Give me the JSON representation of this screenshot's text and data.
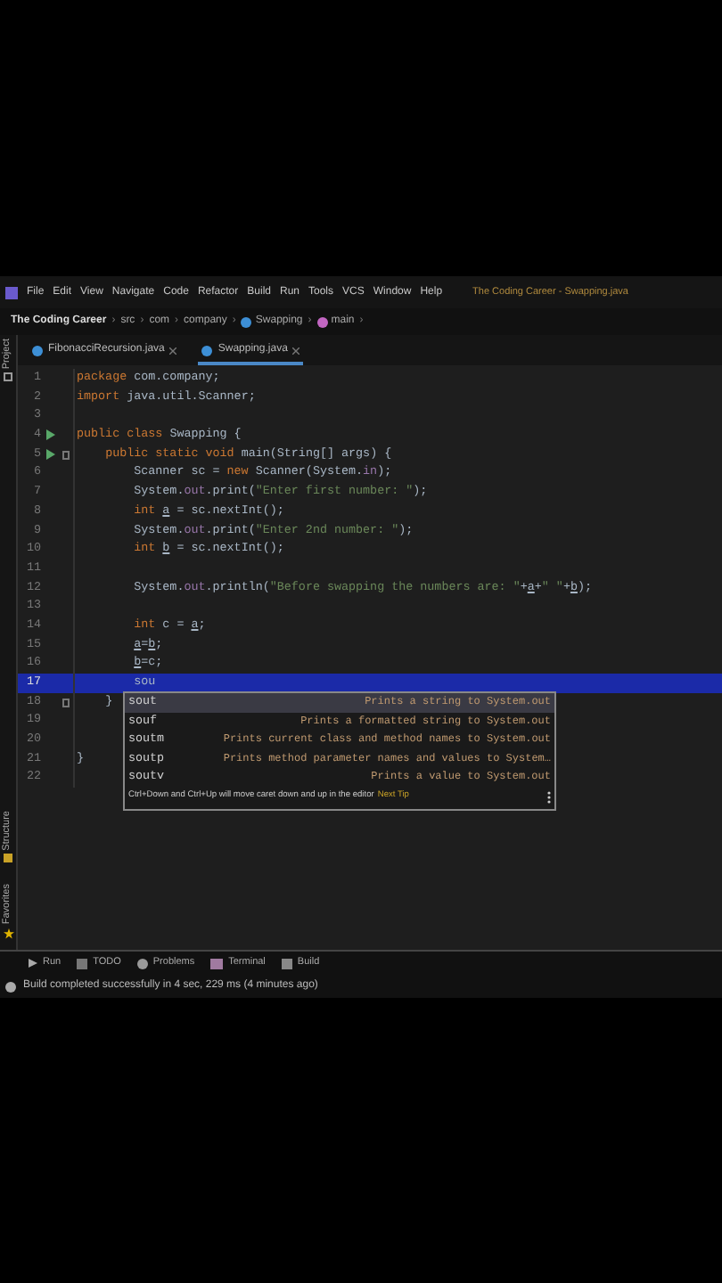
{
  "menu": [
    "File",
    "Edit",
    "View",
    "Navigate",
    "Code",
    "Refactor",
    "Build",
    "Run",
    "Tools",
    "VCS",
    "Window",
    "Help"
  ],
  "window": {
    "title": "The Coding Career - Swapping.java"
  },
  "breadcrumbs": {
    "separator": "›",
    "items": [
      {
        "label": "The Coding Career",
        "kind": "project"
      },
      {
        "label": "src",
        "kind": "folder"
      },
      {
        "label": "com",
        "kind": "folder"
      },
      {
        "label": "company",
        "kind": "folder"
      },
      {
        "label": "Swapping",
        "kind": "class"
      },
      {
        "label": "main",
        "kind": "method"
      }
    ]
  },
  "tabs": [
    {
      "label": "FibonacciRecursion.java",
      "selected": false
    },
    {
      "label": "Swapping.java",
      "selected": true
    }
  ],
  "side_tools_top": [
    {
      "label": "Project",
      "kind": "project"
    }
  ],
  "side_tools_bottom": [
    {
      "label": "Structure",
      "kind": "structure"
    },
    {
      "label": "Favorites",
      "kind": "favorites"
    }
  ],
  "lines": [
    {
      "number": "1",
      "current": false,
      "run": false,
      "fold": false,
      "segments": [
        {
          "text": "package",
          "kind": "keyword"
        },
        {
          "text": " com.company;",
          "kind": "plain"
        }
      ]
    },
    {
      "number": "2",
      "current": false,
      "run": false,
      "fold": false,
      "segments": [
        {
          "text": "import",
          "kind": "keyword"
        },
        {
          "text": " java.util.Scanner;",
          "kind": "plain"
        }
      ]
    },
    {
      "number": "3",
      "current": false,
      "run": false,
      "fold": false
    },
    {
      "number": "4",
      "current": false,
      "run": true,
      "fold": false,
      "segments": [
        {
          "text": "public class",
          "kind": "keyword"
        },
        {
          "text": " Swapping {",
          "kind": "plain"
        }
      ]
    },
    {
      "number": "5",
      "current": false,
      "run": true,
      "fold": true,
      "segments": [
        {
          "text": "    public static void",
          "kind": "keyword"
        },
        {
          "text": " main(String[] args) {",
          "kind": "plain"
        }
      ]
    },
    {
      "number": "6",
      "current": false,
      "run": false,
      "fold": false,
      "segments": [
        {
          "text": "        Scanner sc = ",
          "kind": "plain"
        },
        {
          "text": "new",
          "kind": "keyword"
        },
        {
          "text": " Scanner(System.",
          "kind": "plain"
        },
        {
          "text": "in",
          "kind": "field"
        },
        {
          "text": ");",
          "kind": "plain"
        }
      ]
    },
    {
      "number": "7",
      "current": false,
      "run": false,
      "fold": false,
      "segments": [
        {
          "text": "        System.",
          "kind": "plain"
        },
        {
          "text": "out",
          "kind": "field"
        },
        {
          "text": ".print(",
          "kind": "plain"
        },
        {
          "text": "\"Enter first number: \"",
          "kind": "string"
        },
        {
          "text": ");",
          "kind": "plain"
        }
      ]
    },
    {
      "number": "8",
      "current": false,
      "run": false,
      "fold": false,
      "segments": [
        {
          "text": "        int",
          "kind": "keyword"
        },
        {
          "text": " a",
          "kind": "var"
        },
        {
          "text": " = sc.nextInt();",
          "kind": "plain"
        }
      ]
    },
    {
      "number": "9",
      "current": false,
      "run": false,
      "fold": false,
      "segments": [
        {
          "text": "        System.",
          "kind": "plain"
        },
        {
          "text": "out",
          "kind": "field"
        },
        {
          "text": ".print(",
          "kind": "plain"
        },
        {
          "text": "\"Enter 2nd number: \"",
          "kind": "string"
        },
        {
          "text": ");",
          "kind": "plain"
        }
      ]
    },
    {
      "number": "10",
      "current": false,
      "run": false,
      "fold": false,
      "segments": [
        {
          "text": "        int",
          "kind": "keyword"
        },
        {
          "text": " b",
          "kind": "var"
        },
        {
          "text": " = sc.nextInt();",
          "kind": "plain"
        }
      ]
    },
    {
      "number": "11",
      "current": false,
      "run": false,
      "fold": false
    },
    {
      "number": "12",
      "current": false,
      "run": false,
      "fold": false,
      "segments": [
        {
          "text": "        System.",
          "kind": "plain"
        },
        {
          "text": "out",
          "kind": "field"
        },
        {
          "text": ".println(",
          "kind": "plain"
        },
        {
          "text": "\"Before swapping the numbers are: \"",
          "kind": "string"
        },
        {
          "text": "+",
          "kind": "plain"
        },
        {
          "text": "a",
          "kind": "var"
        },
        {
          "text": "+",
          "kind": "plain"
        },
        {
          "text": "\" \"",
          "kind": "string"
        },
        {
          "text": "+",
          "kind": "plain"
        },
        {
          "text": "b",
          "kind": "var"
        },
        {
          "text": ");",
          "kind": "plain"
        }
      ]
    },
    {
      "number": "13",
      "current": false,
      "run": false,
      "fold": false
    },
    {
      "number": "14",
      "current": false,
      "run": false,
      "fold": false,
      "segments": [
        {
          "text": "        int",
          "kind": "keyword"
        },
        {
          "text": " c = ",
          "kind": "plain"
        },
        {
          "text": "a",
          "kind": "var"
        },
        {
          "text": ";",
          "kind": "plain"
        }
      ]
    },
    {
      "number": "15",
      "current": false,
      "run": false,
      "fold": false,
      "segments": [
        {
          "text": "        a",
          "kind": "var"
        },
        {
          "text": "=",
          "kind": "plain"
        },
        {
          "text": "b",
          "kind": "var"
        },
        {
          "text": ";",
          "kind": "plain"
        }
      ]
    },
    {
      "number": "16",
      "current": false,
      "run": false,
      "fold": false,
      "segments": [
        {
          "text": "        b",
          "kind": "var"
        },
        {
          "text": "=c;",
          "kind": "plain"
        }
      ]
    },
    {
      "number": "17",
      "current": true,
      "run": false,
      "fold": false,
      "segments": [
        {
          "text": "        sou",
          "kind": "plain"
        }
      ]
    },
    {
      "number": "18",
      "current": false,
      "run": false,
      "fold": true,
      "segments": [
        {
          "text": "    }",
          "kind": "plain"
        }
      ]
    },
    {
      "number": "19",
      "current": false,
      "run": false,
      "fold": false
    },
    {
      "number": "20",
      "current": false,
      "run": false,
      "fold": false
    },
    {
      "number": "21",
      "current": false,
      "run": false,
      "fold": false,
      "segments": [
        {
          "text": "}",
          "kind": "plain"
        }
      ]
    },
    {
      "number": "22",
      "current": false,
      "run": false,
      "fold": false
    }
  ],
  "completion": {
    "items": [
      {
        "abbr": "sout",
        "description": "Prints a string to System.out",
        "selected": true
      },
      {
        "abbr": "souf",
        "description": "Prints a formatted string to System.out",
        "selected": false
      },
      {
        "abbr": "soutm",
        "description": "Prints current class and method names to System.out",
        "selected": false
      },
      {
        "abbr": "soutp",
        "description": "Prints method parameter names and values to System…",
        "selected": false
      },
      {
        "abbr": "soutv",
        "description": "Prints a value to System.out",
        "selected": false
      }
    ],
    "tip": "Ctrl+Down and Ctrl+Up will move caret down and up in the editor",
    "tip_link": "Next Tip"
  },
  "tool_windows": [
    {
      "label": "Run",
      "kind": "run"
    },
    {
      "label": "TODO",
      "kind": "todo"
    },
    {
      "label": "Problems",
      "kind": "problems"
    },
    {
      "label": "Terminal",
      "kind": "terminal"
    },
    {
      "label": "Build",
      "kind": "build"
    }
  ],
  "status_bar": "Build completed successfully in 4 sec, 229 ms (4 minutes ago)"
}
